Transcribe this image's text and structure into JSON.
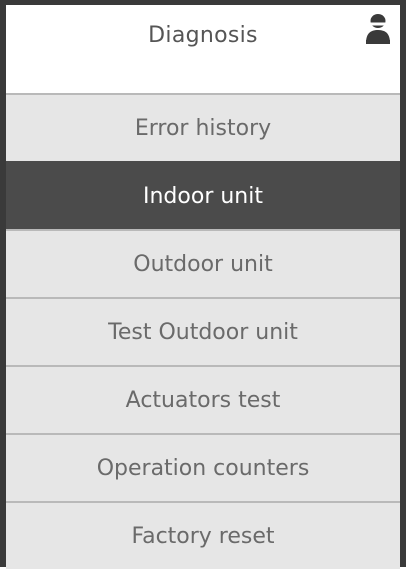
{
  "header": {
    "title": "Diagnosis",
    "user_icon": "user-icon"
  },
  "menu": {
    "items": [
      {
        "label": "Error history",
        "selected": false
      },
      {
        "label": "Indoor unit",
        "selected": true
      },
      {
        "label": "Outdoor unit",
        "selected": false
      },
      {
        "label": "Test Outdoor unit",
        "selected": false
      },
      {
        "label": "Actuators test",
        "selected": false
      },
      {
        "label": "Operation counters",
        "selected": false
      },
      {
        "label": "Factory reset",
        "selected": false
      }
    ]
  },
  "colors": {
    "frame": "#3a3a3a",
    "item_bg": "#e6e6e6",
    "item_text": "#6a6a6a",
    "active_bg": "#4b4b4b",
    "active_text": "#ffffff",
    "divider": "#b9b9b9"
  }
}
